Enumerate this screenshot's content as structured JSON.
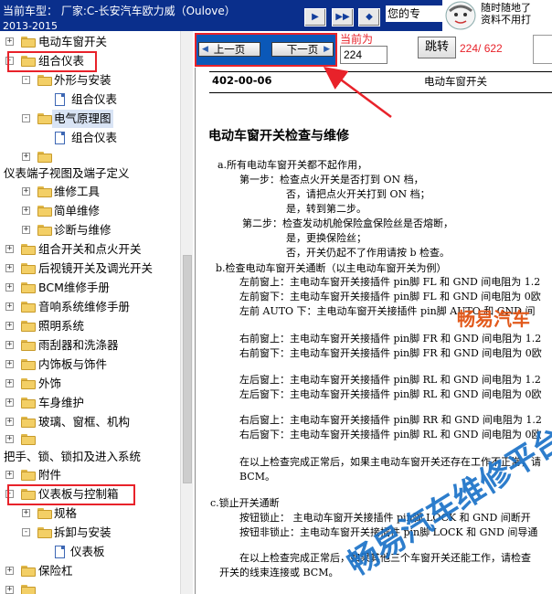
{
  "titlebar": {
    "line1": "当前车型：  厂家:C-长安汽车欧力威（Oulove）",
    "line2": "2013-2015",
    "nav_label": "您的专",
    "promo_line1": "随时随地了",
    "promo_line2": "资料不用打"
  },
  "tree": {
    "items": [
      {
        "label": "电动车窗开关",
        "icon": "folder-icon",
        "expander": "+"
      },
      {
        "label": "组合仪表",
        "icon": "folder-icon",
        "expander": "-"
      },
      {
        "label": "外形与安装",
        "icon": "folder-icon",
        "expander": "-"
      },
      {
        "label": "组合仪表",
        "icon": "document-icon"
      },
      {
        "label": "电气原理图",
        "icon": "folder-icon",
        "expander": "-"
      },
      {
        "label": "组合仪表",
        "icon": "document-icon"
      },
      {
        "label": "",
        "icon": "folder-icon",
        "expander": "+"
      },
      {
        "label": "仪表端子视图及端子定义"
      },
      {
        "label": "维修工具",
        "icon": "folder-icon",
        "expander": "+"
      },
      {
        "label": "简单维修",
        "icon": "folder-icon",
        "expander": "+"
      },
      {
        "label": "诊断与维修",
        "icon": "folder-icon",
        "expander": "+"
      },
      {
        "label": "组合开关和点火开关",
        "icon": "folder-icon",
        "expander": "+"
      },
      {
        "label": "后视镜开关及调光开关",
        "icon": "folder-icon",
        "expander": "+"
      },
      {
        "label": "BCM维修手册",
        "icon": "folder-icon",
        "expander": "+"
      },
      {
        "label": "音响系统维修手册",
        "icon": "folder-icon",
        "expander": "+"
      },
      {
        "label": "照明系统",
        "icon": "folder-icon",
        "expander": "+"
      },
      {
        "label": "雨刮器和洗涤器",
        "icon": "folder-icon",
        "expander": "+"
      },
      {
        "label": "内饰板与饰件",
        "icon": "folder-icon",
        "expander": "+"
      },
      {
        "label": "外饰",
        "icon": "folder-icon",
        "expander": "+"
      },
      {
        "label": "车身维护",
        "icon": "folder-icon",
        "expander": "+"
      },
      {
        "label": "玻璃、窗框、机构",
        "icon": "folder-icon",
        "expander": "+"
      },
      {
        "label": "",
        "icon": "folder-icon",
        "expander": "+"
      },
      {
        "label": "把手、锁、锁扣及进入系统"
      },
      {
        "label": "附件",
        "icon": "folder-icon",
        "expander": "+"
      },
      {
        "label": "仪表板与控制箱",
        "icon": "folder-icon",
        "expander": "-"
      },
      {
        "label": "规格",
        "icon": "folder-icon",
        "expander": "+"
      },
      {
        "label": "拆卸与安装",
        "icon": "folder-icon",
        "expander": "-"
      },
      {
        "label": "仪表板",
        "icon": "document-icon"
      },
      {
        "label": "保险杠",
        "icon": "folder-icon",
        "expander": "+"
      },
      {
        "label": "",
        "icon": "folder-icon",
        "expander": "+"
      }
    ]
  },
  "toolbar": {
    "prev_label": "上一页",
    "next_label": "下一页",
    "current_label": "当前为",
    "page_value": "224",
    "jump_label": "跳转",
    "page_count": "224/ 622"
  },
  "doc": {
    "header_code": "402-00-06",
    "header_title": "电动车窗开关",
    "section_title": "电动车窗开关检查与维修",
    "lines": [
      "a.所有电动车窗开关都不起作用，",
      "第一步：检查点火开关是否打到 ON 档，",
      "否，请把点火开关打到 ON 档；",
      "是，转到第二步。",
      "第二步：检查发动机舱保险盒保险丝是否熔断，",
      "是，更换保险丝；",
      "否，开关仍起不了作用请按 b 检查。",
      "b.检查电动车窗开关通断（以主电动车窗开关为例）",
      "左前窗上：主电动车窗开关接插件 pin脚 FL 和 GND 间电阻为 1.2",
      "左前窗下：主电动车窗开关接插件 pin脚 FL 和 GND 间电阻为 0欧",
      "左前 AUTO 下：主电动车窗开关接插件 pin脚 AUTO 和 GND 间",
      "右前窗上：主电动车窗开关接插件 pin脚 FR 和 GND 间电阻为 1.2",
      "右前窗下：主电动车窗开关接插件 pin脚 FR 和 GND 间电阻为 0欧",
      "左后窗上：主电动车窗开关接插件 pin脚 RL 和 GND 间电阻为 1.2",
      "左后窗下：主电动车窗开关接插件 pin脚 RL 和 GND 间电阻为 0欧",
      "右后窗上：主电动车窗开关接插件 pin脚 RR 和 GND 间电阻为 1.2",
      "右后窗下：主电动车窗开关接插件 pin脚 RL 和 GND 间电阻为 0欧",
      "在以上检查完成正常后，如果主电动车窗开关还存在工作不正常，请",
      "BCM。",
      "c.锁止开关通断",
      "按钮锁止：  主电动车窗开关接插件 pin脚 LOCK 和 GND 间断开",
      "按钮非锁止：主电动车窗开关接插件 pin脚 LOCK 和 GND 间导通",
      "在以上检查完成正常后，如果其他三个车窗开关还能工作，请检查",
      "开关的线束连接或 BCM。"
    ]
  },
  "watermarks": {
    "wm1": "畅易汽车",
    "wm2": "畅易汽车维修平台"
  },
  "colors": {
    "titlebar": "#0a2f8c",
    "highlight": "#e8222a",
    "nav_group": "#0b58b8"
  }
}
